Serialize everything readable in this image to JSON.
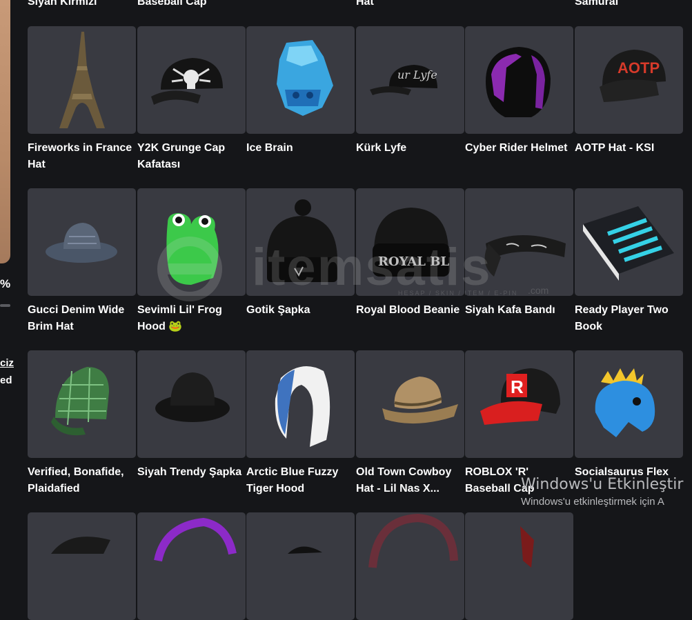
{
  "prev_row_titles": [
    "Siyah Kırmızı",
    "Baseball Cap",
    "Hat",
    "Samurai"
  ],
  "left_panel": {
    "percent": "%",
    "link": "ciz",
    "text": "ed"
  },
  "items": [
    {
      "name": "Fireworks in France Hat",
      "icon": "eiffel-tower-hat-icon"
    },
    {
      "name": "Y2K Grunge Cap Kafatası",
      "icon": "skull-cap-icon"
    },
    {
      "name": "Ice Brain",
      "icon": "ice-brain-icon"
    },
    {
      "name": "Kürk Lyfe",
      "icon": "black-cap-icon"
    },
    {
      "name": "Cyber Rider Helmet",
      "icon": "cyber-helmet-icon"
    },
    {
      "name": "AOTP Hat - KSI",
      "icon": "aotp-cap-icon"
    },
    {
      "name": "Gucci Denim Wide Brim Hat",
      "icon": "denim-hat-icon"
    },
    {
      "name": "Sevimli Lil' Frog Hood 🐸",
      "icon": "frog-hood-icon"
    },
    {
      "name": "Gotik Şapka",
      "icon": "beanie-icon"
    },
    {
      "name": "Royal Blood Beanie",
      "icon": "royal-beanie-icon"
    },
    {
      "name": "Siyah Kafa Bandı",
      "icon": "bandana-icon"
    },
    {
      "name": "Ready Player Two Book",
      "icon": "book-icon"
    },
    {
      "name": "Verified, Bonafide, Plaidafied",
      "icon": "plaid-cap-icon"
    },
    {
      "name": "Siyah Trendy Şapka",
      "icon": "bucket-hat-icon"
    },
    {
      "name": "Arctic Blue Fuzzy Tiger Hood",
      "icon": "tiger-hood-icon"
    },
    {
      "name": "Old Town Cowboy Hat - Lil Nas X...",
      "icon": "cowboy-hat-icon"
    },
    {
      "name": "ROBLOX 'R' Baseball Cap",
      "icon": "roblox-cap-icon"
    },
    {
      "name": "Socialsaurus Flex",
      "icon": "dino-hat-icon"
    },
    {
      "name": "",
      "icon": "partial-item-icon"
    },
    {
      "name": "",
      "icon": "partial-item-icon"
    },
    {
      "name": "",
      "icon": "partial-item-icon"
    },
    {
      "name": "",
      "icon": "partial-item-icon"
    },
    {
      "name": "",
      "icon": "partial-item-icon"
    }
  ],
  "watermark": {
    "text": "itemsatis",
    "subtitle": "HESAP / SKIN / ITEM / E-PIN",
    "suffix": ".com"
  },
  "windows_activation": {
    "title": "Windows'u Etkinleştir",
    "subtitle": "Windows'u etkinleştirmek için A"
  },
  "colors": {
    "background": "#151619",
    "card": "#393a41",
    "text": "#ffffff"
  }
}
